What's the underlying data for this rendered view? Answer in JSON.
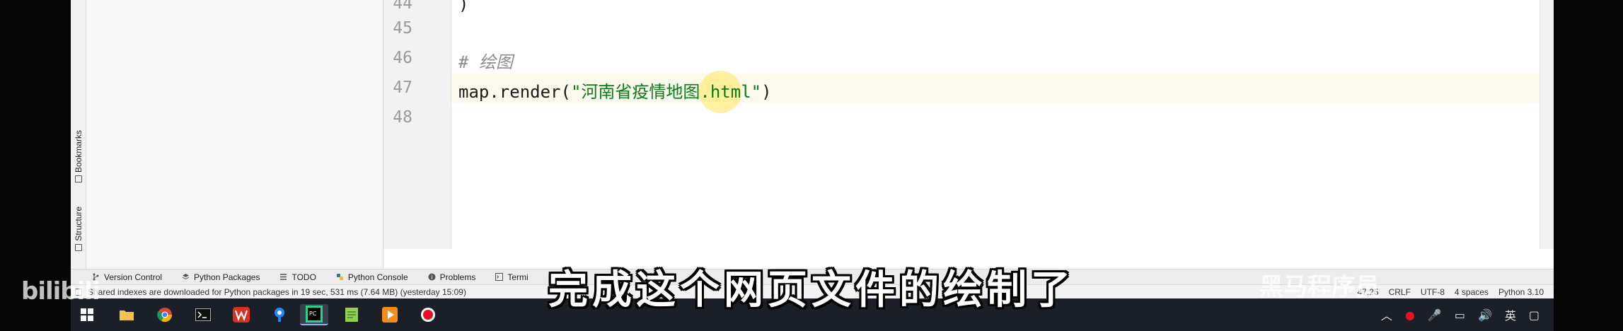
{
  "editor": {
    "line_numbers": [
      "44",
      "45",
      "46",
      "47",
      "48"
    ],
    "lines": [
      {
        "code": ")"
      },
      {
        "code": ""
      },
      {
        "comment": "# 绘图"
      },
      {
        "code_prefix": "map.render(",
        "string": "\"河南省疫情地图.html\"",
        "code_suffix": ")"
      },
      {
        "code": ""
      }
    ]
  },
  "side_tabs": {
    "bookmarks": "Bookmarks",
    "structure": "Structure"
  },
  "tool_windows": [
    {
      "label": "Version Control",
      "icon": "branch-icon"
    },
    {
      "label": "Python Packages",
      "icon": "layers-icon"
    },
    {
      "label": "TODO",
      "icon": "list-icon"
    },
    {
      "label": "Python Console",
      "icon": "python-icon"
    },
    {
      "label": "Problems",
      "icon": "info-icon"
    },
    {
      "label": "Termi",
      "icon": "terminal-icon"
    }
  ],
  "status": {
    "message": "Shared indexes are downloaded for Python packages in 19 sec, 531 ms (7.64 MB) (yesterday 15:09)",
    "position": "47:25",
    "line_sep": "CRLF",
    "encoding": "UTF-8",
    "indent": "4 spaces",
    "interpreter": "Python 3.10"
  },
  "taskbar": {
    "items": [
      "windows-start-icon",
      "file-explorer-icon",
      "chrome-icon",
      "terminal-icon",
      "wps-icon",
      "sourcetree-icon",
      "pycharm-icon",
      "notepad-icon",
      "media-player-icon",
      "record-icon"
    ],
    "tray_lang": "英"
  },
  "overlay": {
    "subtitle": "完成这个网页文件的绘制了",
    "bilibili_logo": "bilibili",
    "brand": "黑马程序员"
  },
  "colors": {
    "string": "#067d17",
    "comment": "#8c8c8c",
    "current_line": "#fcfaed",
    "cursor_highlight": "#ffe65a"
  }
}
